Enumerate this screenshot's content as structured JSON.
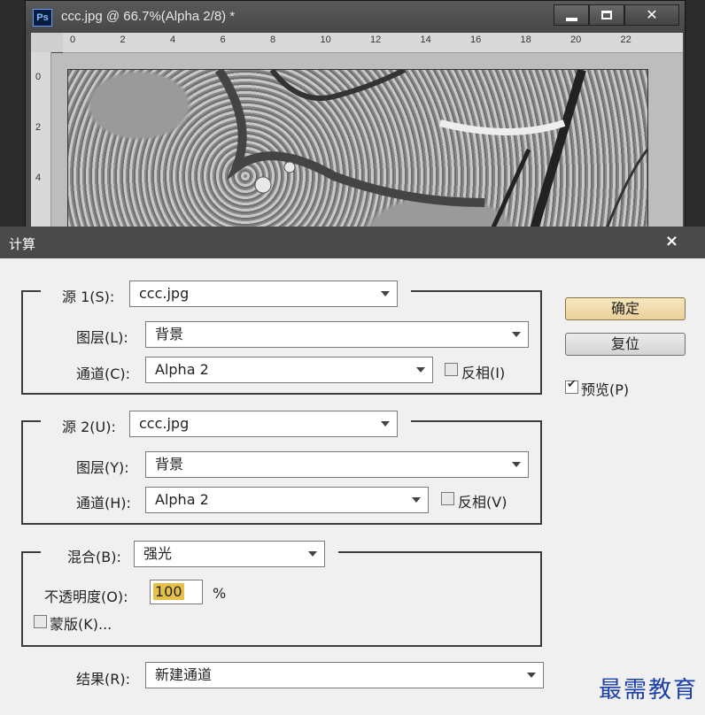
{
  "ps_window": {
    "title": "ccc.jpg @ 66.7%(Alpha 2/8) *",
    "logo": "Ps",
    "ruler_h": [
      "0",
      "2",
      "4",
      "6",
      "8",
      "10",
      "12",
      "14",
      "16",
      "18",
      "20",
      "22"
    ],
    "ruler_v": [
      "0",
      "2",
      "4"
    ],
    "buttons": {
      "minimize": "minimize-icon",
      "maximize": "maximize-icon",
      "close": "✕"
    }
  },
  "dialog": {
    "title": "计算",
    "close": "×",
    "source1": {
      "label": "源 1(S):",
      "file": "ccc.jpg",
      "layer_label": "图层(L):",
      "layer": "背景",
      "channel_label": "通道(C):",
      "channel": "Alpha 2",
      "invert_label": "反相(I)",
      "invert": false
    },
    "source2": {
      "label": "源 2(U):",
      "file": "ccc.jpg",
      "layer_label": "图层(Y):",
      "layer": "背景",
      "channel_label": "通道(H):",
      "channel": "Alpha 2",
      "invert_label": "反相(V)",
      "invert": false
    },
    "blend": {
      "label": "混合(B):",
      "mode": "强光",
      "opacity_label": "不透明度(O):",
      "opacity": "100",
      "opacity_unit": "%",
      "mask_label": "蒙版(K)...",
      "mask": false
    },
    "result": {
      "label": "结果(R):",
      "value": "新建通道"
    },
    "buttons": {
      "ok": "确定",
      "reset": "复位"
    },
    "preview": {
      "label": "预览(P)",
      "checked": true
    }
  },
  "watermark": "最需教育"
}
